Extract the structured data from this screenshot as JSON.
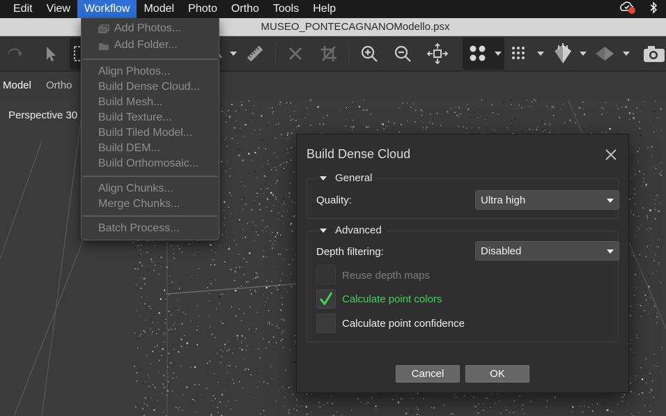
{
  "menubar": {
    "items": [
      "Edit",
      "View",
      "Workflow",
      "Model",
      "Photo",
      "Ortho",
      "Tools",
      "Help"
    ],
    "active": "Workflow",
    "status_icons": [
      "cloud-status-icon",
      "bluetooth-icon"
    ]
  },
  "window": {
    "title": "MUSEO_PONTECAGNANOModello.psx"
  },
  "toolbar": {
    "icons": [
      "rotate-icon",
      "pointer-icon",
      "rect-select-icon",
      "ruler-icon",
      "delete-icon",
      "crop-icon",
      "zoom-in-icon",
      "zoom-out-icon",
      "reset-view-icon",
      "show-cameras-icon",
      "point-cloud-icon",
      "shaded-model-icon",
      "textured-model-icon",
      "camera-icon"
    ]
  },
  "tabs": {
    "model": "Model",
    "ortho": "Ortho"
  },
  "viewport": {
    "label": "Perspective 30"
  },
  "workflow_menu": {
    "add_photos": "Add Photos...",
    "add_folder": "Add Folder...",
    "align_photos": "Align Photos...",
    "build_dense_cloud": "Build Dense Cloud...",
    "build_mesh": "Build Mesh...",
    "build_texture": "Build Texture...",
    "build_tiled_model": "Build Tiled Model...",
    "build_dem": "Build DEM...",
    "build_orthomosaic": "Build Orthomosaic...",
    "align_chunks": "Align Chunks...",
    "merge_chunks": "Merge Chunks...",
    "batch_process": "Batch Process..."
  },
  "dialog": {
    "title": "Build Dense Cloud",
    "general": {
      "heading": "General",
      "quality_label": "Quality:",
      "quality_value": "Ultra high"
    },
    "advanced": {
      "heading": "Advanced",
      "depth_filtering_label": "Depth filtering:",
      "depth_filtering_value": "Disabled",
      "reuse_depth_maps": "Reuse depth maps",
      "reuse_depth_maps_checked": false,
      "calc_point_colors": "Calculate point colors",
      "calc_point_colors_checked": true,
      "calc_point_confidence": "Calculate point confidence",
      "calc_point_confidence_checked": false
    },
    "cancel": "Cancel",
    "ok": "OK"
  },
  "colors": {
    "accent_menu": "#2d6fd6",
    "check_green": "#3ed45a",
    "disabled_text": "#8f8f8f"
  }
}
